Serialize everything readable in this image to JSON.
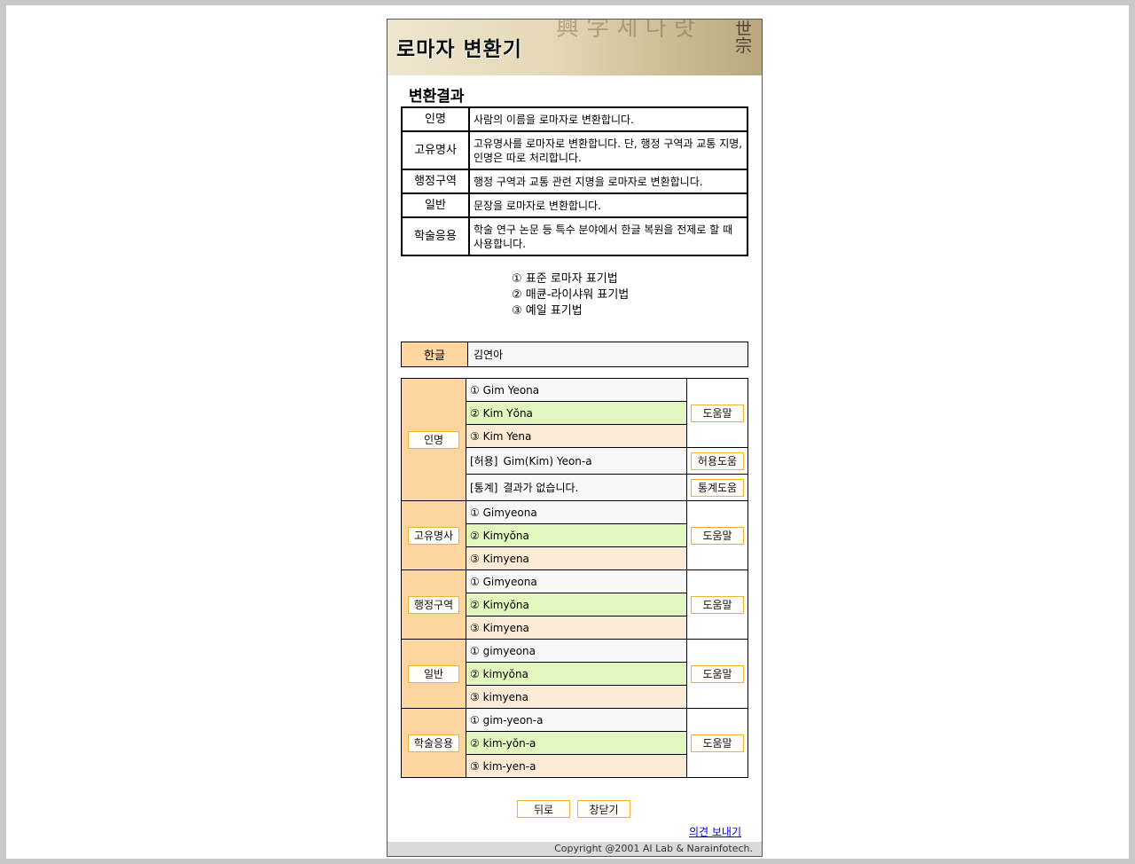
{
  "header": {
    "title": "로마자 변환기",
    "decor_left": "興 字 세 나 랏",
    "decor_right": "世 宗"
  },
  "section_title": "변환결과",
  "descriptions": [
    {
      "key": "인명",
      "text": "사람의 이름을 로마자로 변환합니다."
    },
    {
      "key": "고유명사",
      "text": "고유명사를 로마자로 변환합니다. 단, 행정 구역과 교통 지명, 인명은 따로 처리합니다."
    },
    {
      "key": "행정구역",
      "text": "행정 구역과 교통 관련 지명을 로마자로 변환합니다."
    },
    {
      "key": "일반",
      "text": "문장을 로마자로 변환합니다."
    },
    {
      "key": "학술응용",
      "text": "학술 연구 논문 등 특수 분야에서 한글 복원을 전제로 할 때 사용합니다."
    }
  ],
  "legend": [
    "① 표준 로마자 표기법",
    "② 매큔-라이샤워 표기법",
    "③ 예일 표기법"
  ],
  "hangul": {
    "label": "한글",
    "value": "김연아"
  },
  "help_label": "도움말",
  "groups": [
    {
      "label": "인명",
      "rows": [
        "① Gim Yeona",
        "② Kim Yŏna",
        "③ Kim Yena"
      ],
      "extras": [
        {
          "tag": "[허용]",
          "text": "Gim(Kim) Yeon-a",
          "button": "허용도움"
        },
        {
          "tag": "[통계]",
          "text": "결과가 없습니다.",
          "button": "통계도움"
        }
      ]
    },
    {
      "label": "고유명사",
      "rows": [
        "① Gimyeona",
        "② Kimyŏna",
        "③ Kimyena"
      ]
    },
    {
      "label": "행정구역",
      "rows": [
        "① Gimyeona",
        "② Kimyŏna",
        "③ Kimyena"
      ]
    },
    {
      "label": "일반",
      "rows": [
        "① gimyeona",
        "② kimyŏna",
        "③ kimyena"
      ]
    },
    {
      "label": "학술응용",
      "rows": [
        "① gim-yeon-a",
        "② kim-yŏn-a",
        "③ kim-yen-a"
      ]
    }
  ],
  "buttons": {
    "back": "뒤로",
    "close": "창닫기"
  },
  "feedback_link": "의견 보내기",
  "footer": "Copyright @2001 AI Lab & Narainfotech."
}
